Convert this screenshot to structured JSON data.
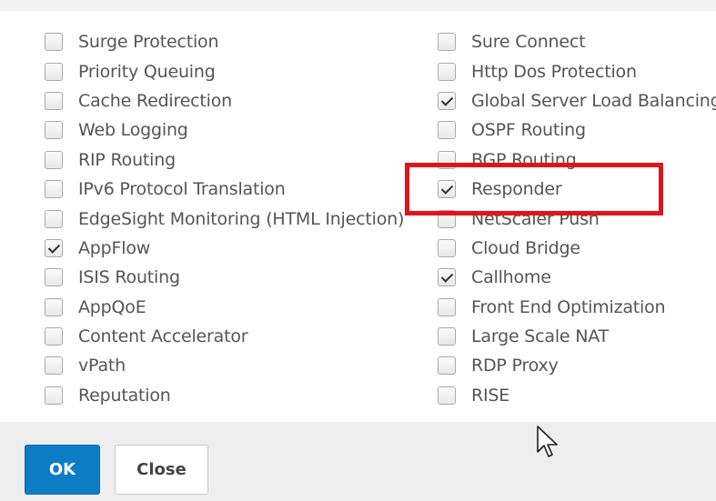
{
  "features_left": [
    {
      "label": "Surge Protection",
      "checked": false
    },
    {
      "label": "Priority Queuing",
      "checked": false
    },
    {
      "label": "Cache Redirection",
      "checked": false
    },
    {
      "label": "Web Logging",
      "checked": false
    },
    {
      "label": "RIP Routing",
      "checked": false
    },
    {
      "label": "IPv6 Protocol Translation",
      "checked": false
    },
    {
      "label": "EdgeSight Monitoring (HTML Injection)",
      "checked": false
    },
    {
      "label": "AppFlow",
      "checked": true
    },
    {
      "label": "ISIS Routing",
      "checked": false
    },
    {
      "label": "AppQoE",
      "checked": false
    },
    {
      "label": "Content Accelerator",
      "checked": false
    },
    {
      "label": "vPath",
      "checked": false
    },
    {
      "label": "Reputation",
      "checked": false
    }
  ],
  "features_right": [
    {
      "label": "Sure Connect",
      "checked": false
    },
    {
      "label": "Http Dos Protection",
      "checked": false
    },
    {
      "label": "Global Server Load Balancing",
      "checked": true
    },
    {
      "label": "OSPF Routing",
      "checked": false
    },
    {
      "label": "BGP Routing",
      "checked": false
    },
    {
      "label": "Responder",
      "checked": true
    },
    {
      "label": "NetScaler Push",
      "checked": false
    },
    {
      "label": "Cloud Bridge",
      "checked": false
    },
    {
      "label": "Callhome",
      "checked": true
    },
    {
      "label": "Front End Optimization",
      "checked": false
    },
    {
      "label": "Large Scale NAT",
      "checked": false
    },
    {
      "label": "RDP Proxy",
      "checked": false
    },
    {
      "label": "RISE",
      "checked": false
    }
  ],
  "buttons": {
    "ok_label": "OK",
    "close_label": "Close"
  },
  "colors": {
    "highlight": "#e0141b",
    "primary": "#0f7cc6"
  },
  "icons": {
    "checkbox": "checkbox-icon",
    "cursor": "mouse-cursor-icon"
  }
}
